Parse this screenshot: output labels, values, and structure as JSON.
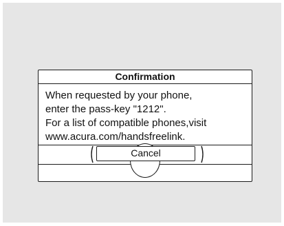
{
  "dialog": {
    "title": "Confirmation",
    "lines": [
      "When requested by your phone,",
      "enter the pass-key \"1212\".",
      "For a list of compatible phones,visit",
      "www.acura.com/handsfreelink."
    ],
    "cancel_label": "Cancel"
  }
}
